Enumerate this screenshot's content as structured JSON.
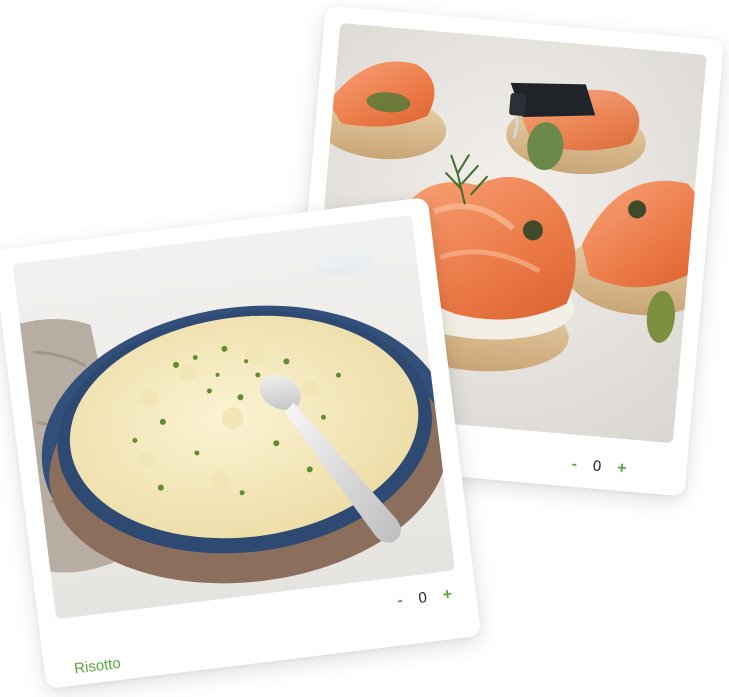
{
  "cards": [
    {
      "image": "smoked-salmon-crostini",
      "title": "",
      "counter": {
        "decrement_label": "-",
        "value": "0",
        "increment_label": "+"
      }
    },
    {
      "image": "risotto",
      "title": "Risotto",
      "counter": {
        "decrement_label": "-",
        "value": "0",
        "increment_label": "+"
      }
    }
  ],
  "colors": {
    "accent": "#5aa63f",
    "card": "#ffffff",
    "text": "#222222"
  }
}
